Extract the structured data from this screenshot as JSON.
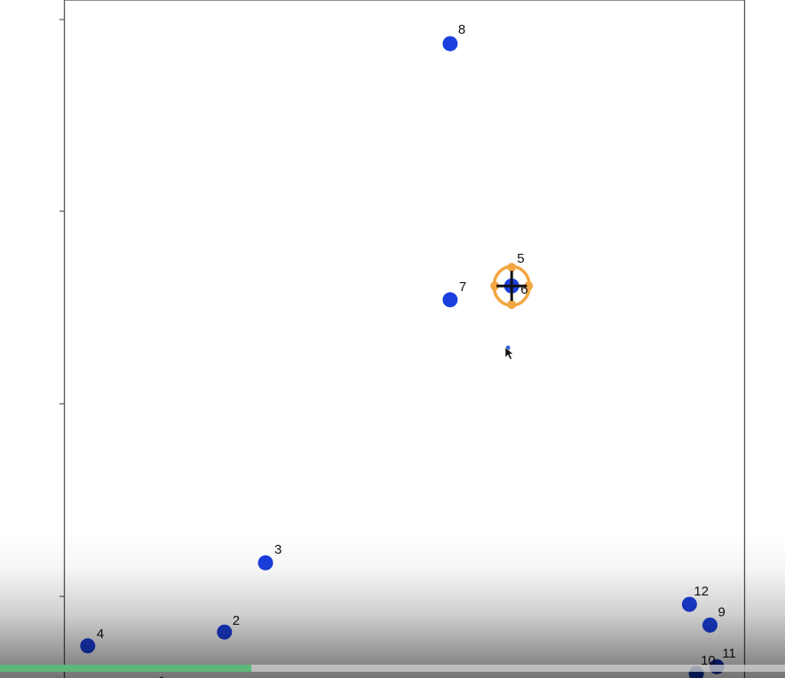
{
  "chart_data": {
    "type": "scatter",
    "title": "",
    "xlabel": "",
    "ylabel": "",
    "xlim": [
      0,
      100
    ],
    "ylim": [
      0,
      100
    ],
    "grid": false,
    "points": [
      {
        "label": "1",
        "x": 13,
        "y": 2,
        "color": "#0f2fa8"
      },
      {
        "label": "2",
        "x": 24,
        "y": 11,
        "color": "#1a3fdf"
      },
      {
        "label": "3",
        "x": 30,
        "y": 21,
        "color": "#1a3fdf"
      },
      {
        "label": "4",
        "x": 4,
        "y": 9,
        "color": "#1a3fdf"
      },
      {
        "label": "5",
        "x": 66,
        "y": 61,
        "color": "#f2a640",
        "selected": true
      },
      {
        "label": "6",
        "x": 66,
        "y": 61,
        "color": "#1a3fdf"
      },
      {
        "label": "7",
        "x": 57,
        "y": 59,
        "color": "#1a3fdf"
      },
      {
        "label": "8",
        "x": 57,
        "y": 96,
        "color": "#1a3fdf"
      },
      {
        "label": "9",
        "x": 95,
        "y": 12,
        "color": "#1a3fdf"
      },
      {
        "label": "10",
        "x": 93,
        "y": 5,
        "color": "#0f2fa8"
      },
      {
        "label": "11",
        "x": 96,
        "y": 6,
        "color": "#0f2fa8"
      },
      {
        "label": "12",
        "x": 92,
        "y": 15,
        "color": "#1a3fdf"
      }
    ]
  },
  "player": {
    "progress": 0.32
  },
  "colors": {
    "axis": "#555555",
    "highlight": "#f2a640",
    "crosshair": "#111111"
  }
}
